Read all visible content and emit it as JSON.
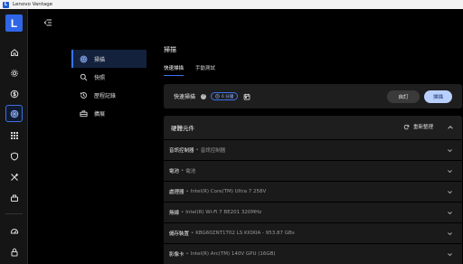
{
  "window": {
    "title": "Lenovo Vantage",
    "logo_letter": "L"
  },
  "rail": {
    "brand_letter": "L",
    "icons": [
      "home-icon",
      "gear-icon",
      "dollar-icon",
      "scan-icon",
      "grid-icon",
      "shield-icon",
      "tools-icon",
      "device-icon",
      "speed-icon",
      "lock-icon"
    ]
  },
  "submenu": {
    "items": [
      {
        "label": "掃描",
        "icon": "scan-icon",
        "active": true
      },
      {
        "label": "快照",
        "icon": "magnifier-icon"
      },
      {
        "label": "歷程記錄",
        "icon": "history-icon"
      },
      {
        "label": "擴展",
        "icon": "toolbox-icon"
      }
    ]
  },
  "main": {
    "title": "掃描",
    "tabs": [
      {
        "label": "快速掃描",
        "active": true
      },
      {
        "label": "手動測試"
      }
    ],
    "quick_scan": {
      "label": "快速掃描",
      "help": "?",
      "pill_text": "6 分鐘",
      "custom_button": "自訂",
      "scan_button": "掃描"
    },
    "hardware": {
      "title": "硬體元件",
      "refresh_label": "重新整理",
      "rows": [
        {
          "key": "音訊控制器",
          "value": "音訊控制器"
        },
        {
          "key": "電池",
          "value": "電池"
        },
        {
          "key": "處理器",
          "value": "Intel(R) Core(TM) Ultra 7 258V"
        },
        {
          "key": "無線",
          "value": "Intel(R) Wi-Fi 7 BE201 320MHz"
        },
        {
          "key": "儲存裝置",
          "value": "KBG60ZNT1T02 LS KIOXIA - 953.87 GBs"
        },
        {
          "key": "影像卡",
          "value": "Intel(R) Arc(TM) 140V GPU (16GB)"
        }
      ]
    }
  },
  "colors": {
    "accent": "#3b73f0",
    "brand": "#2f66e8",
    "scan_button": "#b9d0ff"
  }
}
